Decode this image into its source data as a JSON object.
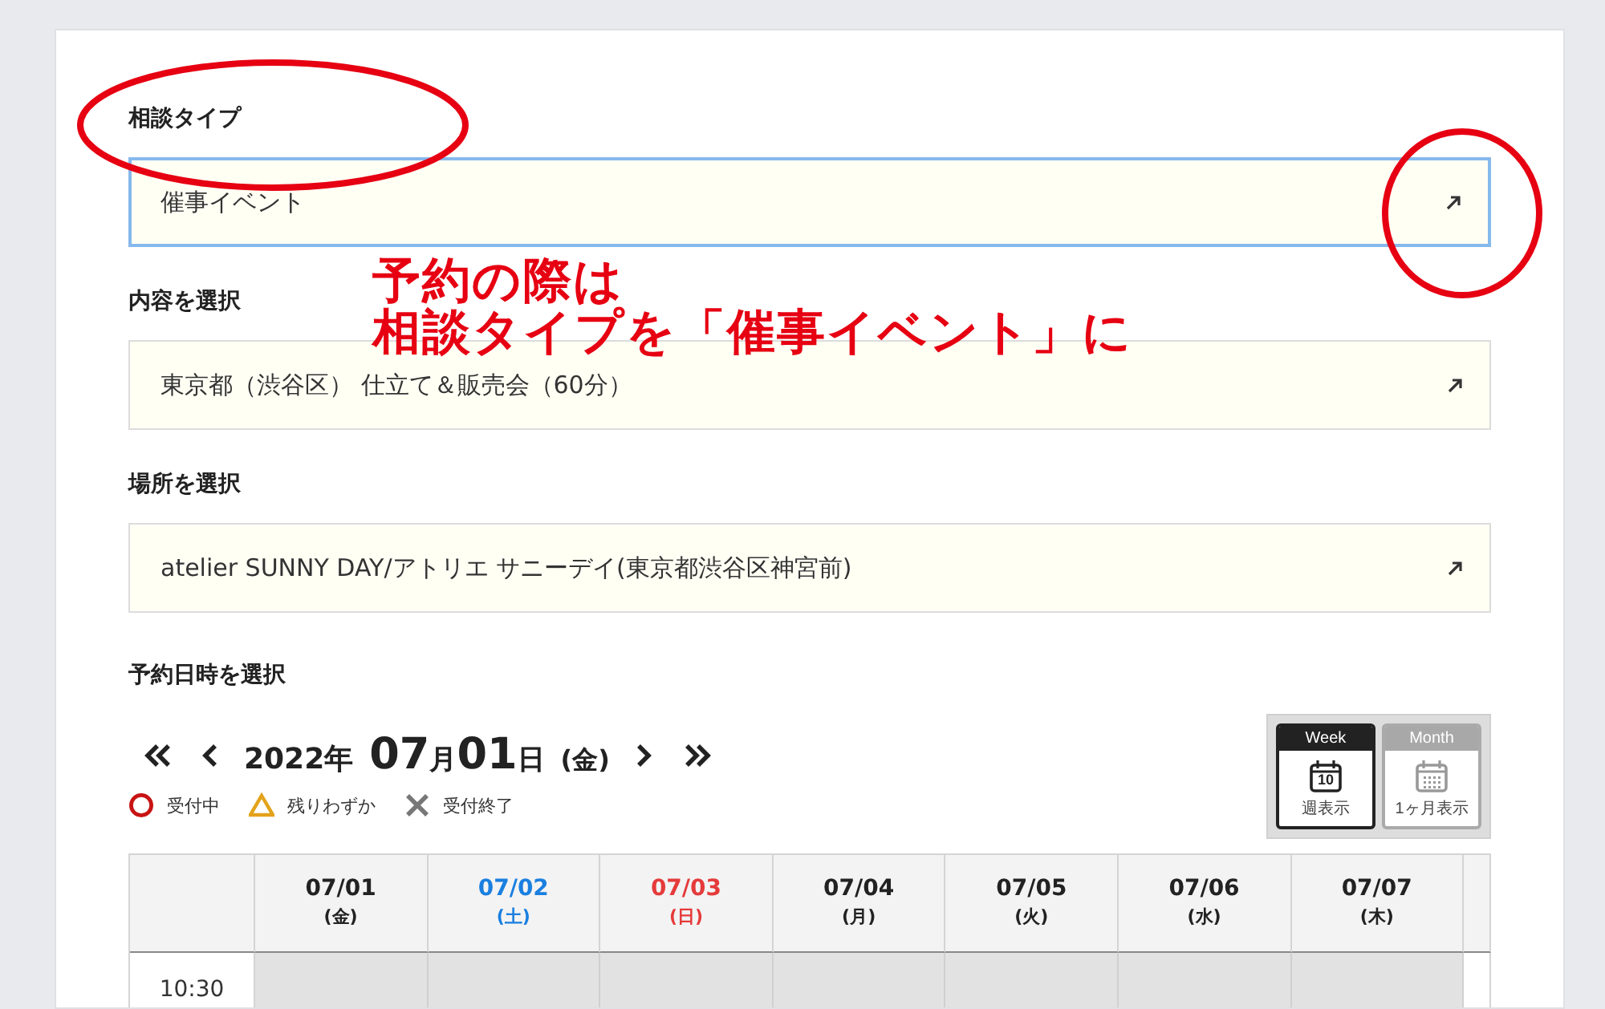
{
  "fields": [
    {
      "label": "相談タイプ",
      "value": "催事イベント",
      "focused": true
    },
    {
      "label": "内容を選択",
      "value": "東京都（渋谷区） 仕立て＆販売会（60分）",
      "focused": false
    },
    {
      "label": "場所を選択",
      "value": "atelier SUNNY DAY/アトリエ サニーデイ(東京都渋谷区神宮前)",
      "focused": false
    }
  ],
  "annotation": {
    "lines": [
      "予約の際は",
      "相談タイプを「催事イベント」に"
    ]
  },
  "date_section": {
    "label": "予約日時を選択",
    "year": "2022年",
    "month": "07",
    "month_unit": "月",
    "day": "01",
    "day_unit": "日",
    "weekday": "(金)"
  },
  "legend": [
    {
      "kind": "circle",
      "label": "受付中"
    },
    {
      "kind": "triangle",
      "label": "残りわずか"
    },
    {
      "kind": "cross",
      "label": "受付終了"
    }
  ],
  "view_toggle": [
    {
      "kind": "week",
      "tab": "Week",
      "icon_number": "10",
      "label": "週表示",
      "selected": true
    },
    {
      "kind": "month",
      "tab": "Month",
      "label": "1ヶ月表示",
      "selected": false
    }
  ],
  "table": {
    "columns": [
      {
        "date": "07/01",
        "weekday": "(金)",
        "color": "#222222"
      },
      {
        "date": "07/02",
        "weekday": "(土)",
        "color": "#1a7fe0"
      },
      {
        "date": "07/03",
        "weekday": "(日)",
        "color": "#e53b3b"
      },
      {
        "date": "07/04",
        "weekday": "(月)",
        "color": "#222222"
      },
      {
        "date": "07/05",
        "weekday": "(火)",
        "color": "#222222"
      },
      {
        "date": "07/06",
        "weekday": "(水)",
        "color": "#222222"
      },
      {
        "date": "07/07",
        "weekday": "(木)",
        "color": "#222222"
      }
    ],
    "rows": [
      {
        "time": "10:30"
      }
    ]
  }
}
